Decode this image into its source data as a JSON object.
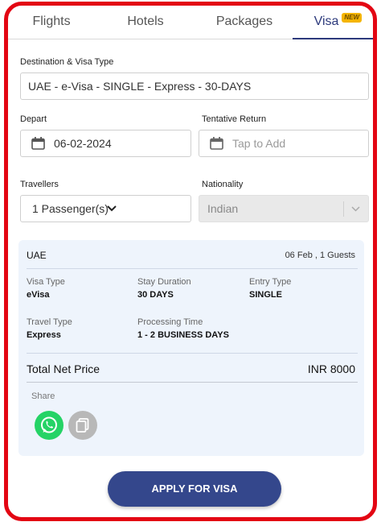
{
  "tabs": [
    {
      "label": "Flights"
    },
    {
      "label": "Hotels"
    },
    {
      "label": "Packages"
    },
    {
      "label": "Visa",
      "badge": "NEW"
    }
  ],
  "form": {
    "destination_label": "Destination & Visa Type",
    "destination_value": "UAE - e-Visa - SINGLE - Express - 30-DAYS",
    "depart_label": "Depart",
    "depart_value": "06-02-2024",
    "return_label": "Tentative Return",
    "return_placeholder": "Tap to Add",
    "travellers_label": "Travellers",
    "travellers_value": "1 Passenger(s)",
    "nationality_label": "Nationality",
    "nationality_value": "Indian"
  },
  "summary": {
    "country": "UAE",
    "trip_info": "06 Feb , 1 Guests",
    "visa_type_label": "Visa Type",
    "visa_type_value": "eVisa",
    "stay_label": "Stay Duration",
    "stay_value": "30 DAYS",
    "entry_label": "Entry Type",
    "entry_value": "SINGLE",
    "travel_label": "Travel Type",
    "travel_value": "Express",
    "processing_label": "Processing Time",
    "processing_value": "1 - 2 BUSINESS DAYS",
    "total_label": "Total Net Price",
    "total_value": "INR 8000",
    "share_label": "Share"
  },
  "apply_label": "APPLY FOR VISA",
  "colors": {
    "accent": "#34478c",
    "frame": "#e30613",
    "whatsapp": "#25d366",
    "badge": "#f4b400"
  },
  "icons": {
    "calendar": "calendar-icon",
    "chevron": "chevron-down-icon",
    "whatsapp": "whatsapp-icon",
    "copy": "copy-icon"
  }
}
